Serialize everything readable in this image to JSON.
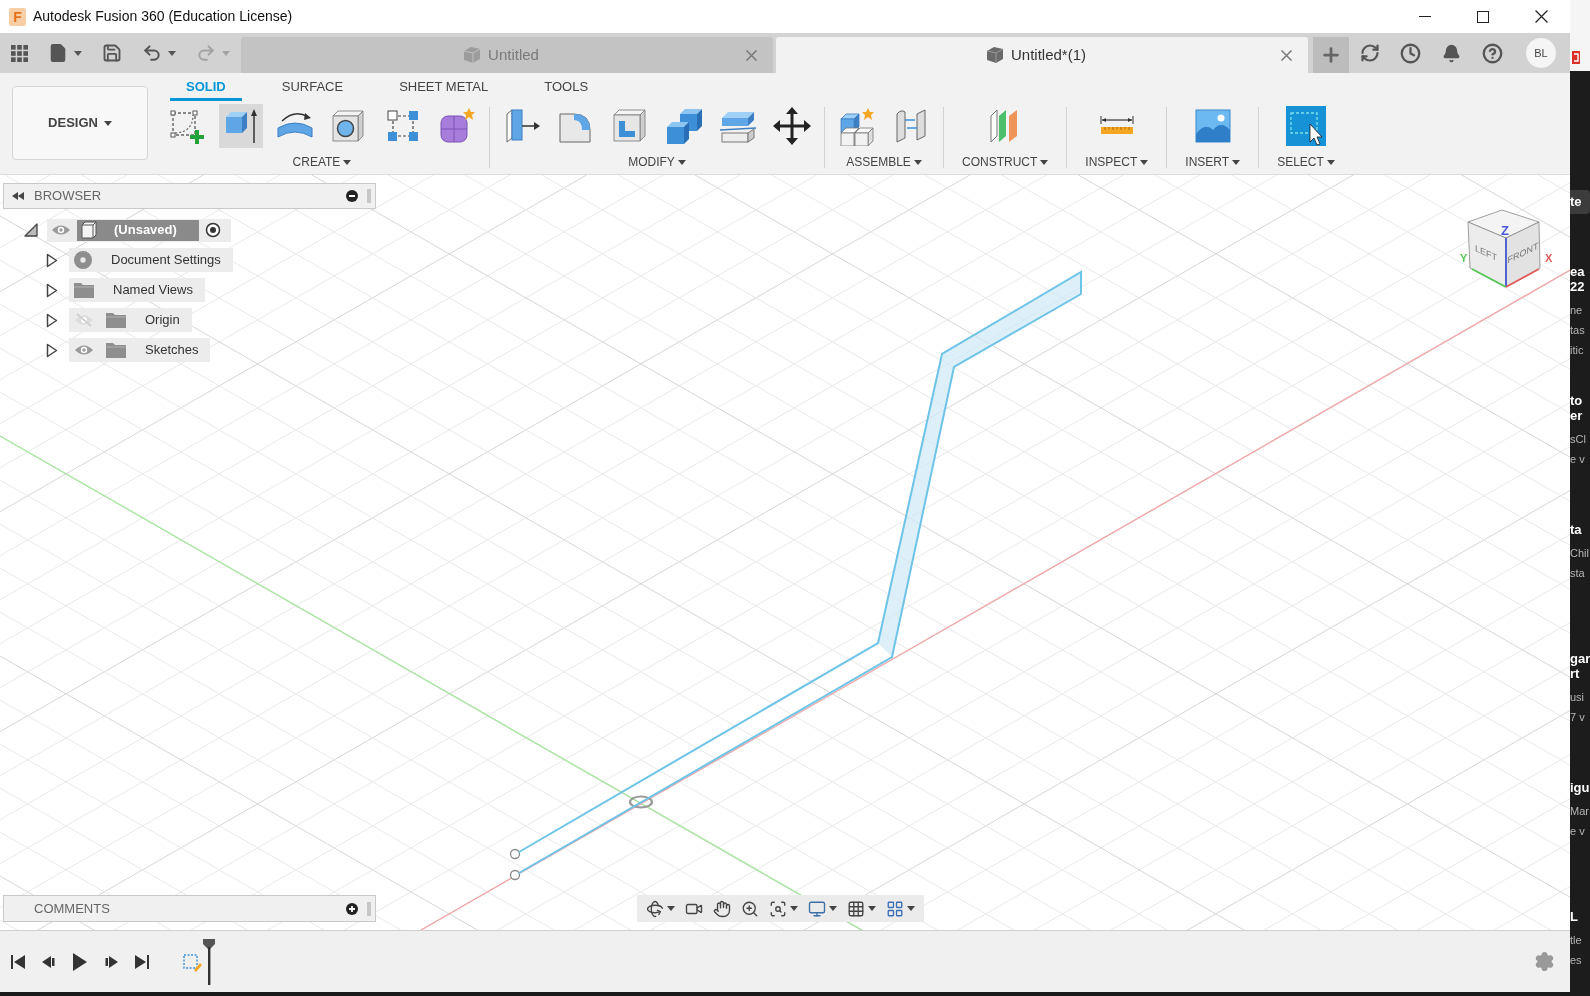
{
  "window": {
    "logo": "F",
    "title": "Autodesk Fusion 360 (Education License)"
  },
  "quick_access": [
    {
      "kind": "apps",
      "dropdown": false,
      "disabled": false
    },
    {
      "kind": "file",
      "dropdown": true,
      "disabled": false
    },
    {
      "kind": "save",
      "dropdown": false,
      "disabled": false
    },
    {
      "kind": "undo",
      "dropdown": true,
      "disabled": false
    },
    {
      "kind": "redo",
      "dropdown": true,
      "disabled": true
    }
  ],
  "document_tabs": [
    {
      "label": "Untitled",
      "selected": false
    },
    {
      "label": "Untitled*(1)",
      "selected": true
    }
  ],
  "header_actions": [
    {
      "kind": "new_tab"
    },
    {
      "kind": "extensions"
    },
    {
      "kind": "job_status"
    },
    {
      "kind": "notifications"
    },
    {
      "kind": "help"
    }
  ],
  "user": {
    "initials": "BL"
  },
  "toolbar": {
    "workspace": "DESIGN",
    "tabs": [
      {
        "label": "SOLID",
        "selected": true
      },
      {
        "label": "SURFACE",
        "selected": false
      },
      {
        "label": "SHEET METAL",
        "selected": false
      },
      {
        "label": "TOOLS",
        "selected": false
      }
    ],
    "groups": [
      {
        "label": "CREATE",
        "tools": [
          {
            "kind": "sketch",
            "highlighted": false
          },
          {
            "kind": "extrude",
            "highlighted": true
          },
          {
            "kind": "revolve",
            "highlighted": false
          },
          {
            "kind": "hole",
            "highlighted": false
          },
          {
            "kind": "pattern",
            "highlighted": false
          },
          {
            "kind": "form",
            "highlighted": false
          }
        ]
      },
      {
        "label": "MODIFY",
        "tools": [
          {
            "kind": "press_pull",
            "highlighted": false
          },
          {
            "kind": "fillet",
            "highlighted": false
          },
          {
            "kind": "shell",
            "highlighted": false
          },
          {
            "kind": "combine",
            "highlighted": false
          },
          {
            "kind": "split",
            "highlighted": false
          },
          {
            "kind": "move",
            "highlighted": false
          }
        ]
      },
      {
        "label": "ASSEMBLE",
        "tools": [
          {
            "kind": "new_component",
            "highlighted": false
          },
          {
            "kind": "joint",
            "highlighted": false
          }
        ]
      },
      {
        "label": "CONSTRUCT",
        "tools": [
          {
            "kind": "plane",
            "highlighted": false
          }
        ]
      },
      {
        "label": "INSPECT",
        "tools": [
          {
            "kind": "measure",
            "highlighted": false
          }
        ]
      },
      {
        "label": "INSERT",
        "tools": [
          {
            "kind": "image",
            "highlighted": false
          }
        ]
      },
      {
        "label": "SELECT",
        "tools": [
          {
            "kind": "select",
            "highlighted": false
          }
        ]
      }
    ]
  },
  "browser": {
    "title": "BROWSER",
    "tree": [
      {
        "label": "(Unsaved)",
        "kind": "component",
        "expanded": true,
        "visible": true,
        "active": true,
        "children": [
          {
            "label": "Document Settings",
            "kind": "settings",
            "expanded": false
          },
          {
            "label": "Named Views",
            "kind": "folder",
            "expanded": false
          },
          {
            "label": "Origin",
            "kind": "folder",
            "expanded": false,
            "visible": false
          },
          {
            "label": "Sketches",
            "kind": "folder",
            "expanded": false,
            "visible": true
          }
        ]
      }
    ]
  },
  "comments": {
    "title": "COMMENTS"
  },
  "view_cube": {
    "faces": [
      {
        "label": "LEFT"
      },
      {
        "label": "FRONT"
      }
    ],
    "axes": [
      {
        "label": "Z",
        "color": "#4a5ad8"
      },
      {
        "label": "Y",
        "color": "#55c855"
      },
      {
        "label": "X",
        "color": "#e05a5a"
      }
    ]
  },
  "navigation_bar": [
    {
      "kind": "orbit",
      "dropdown": true
    },
    {
      "kind": "look_at",
      "dropdown": false
    },
    {
      "kind": "pan",
      "dropdown": false
    },
    {
      "kind": "zoom",
      "dropdown": false
    },
    {
      "kind": "fit",
      "dropdown": true
    },
    {
      "kind": "display",
      "dropdown": true
    },
    {
      "kind": "grid",
      "dropdown": true
    },
    {
      "kind": "viewports",
      "dropdown": true
    }
  ],
  "timeline": {
    "controls": [
      {
        "kind": "first"
      },
      {
        "kind": "previous"
      },
      {
        "kind": "play"
      },
      {
        "kind": "next"
      },
      {
        "kind": "last"
      }
    ],
    "features": [
      {
        "kind": "sketch"
      }
    ]
  },
  "background_window": {
    "button": "te",
    "cards": [
      {
        "heading": [
          "ea",
          "22"
        ],
        "body": [
          "ne",
          "tas",
          "itic"
        ]
      },
      {
        "heading": [
          "to",
          "er"
        ],
        "body": [
          "sCl",
          "e v"
        ]
      },
      {
        "heading": [
          "ta"
        ],
        "body": [
          "Chil",
          "sta"
        ]
      },
      {
        "heading": [
          "gar",
          "rt"
        ],
        "body": [
          "usi",
          "7 v"
        ]
      },
      {
        "heading": [
          "igu"
        ],
        "body": [
          "Mar",
          "e v"
        ]
      },
      {
        "heading": [
          "L"
        ],
        "body": [
          "tle",
          "es"
        ]
      }
    ]
  }
}
